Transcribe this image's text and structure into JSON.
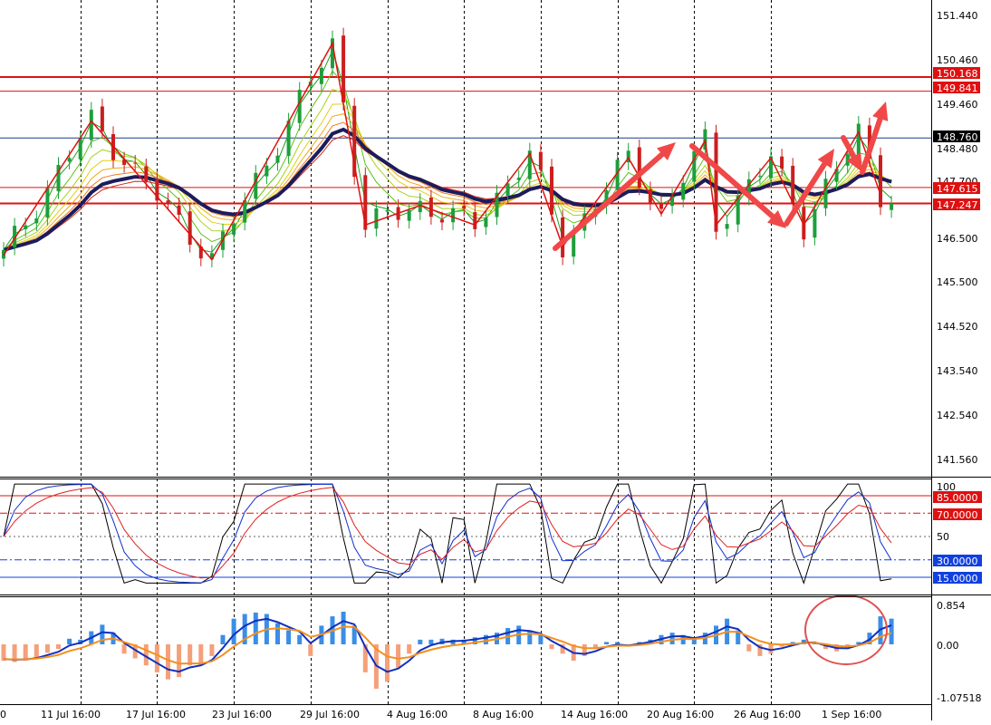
{
  "chart_data": {
    "type": "line",
    "panels": {
      "price": {
        "y_ticks": [
          "151.440",
          "150.460",
          "149.460",
          "148.480",
          "146.500",
          "145.500",
          "144.520",
          "143.540",
          "142.540",
          "141.560"
        ],
        "y_tick_values": [
          151.44,
          150.46,
          149.46,
          148.48,
          146.5,
          145.5,
          144.52,
          143.54,
          142.54,
          141.56
        ],
        "ylim": [
          140.95,
          151.95
        ],
        "horizontal_levels": [
          {
            "label": "150.168",
            "value": 150.168,
            "color": "#e01010"
          },
          {
            "label": "149.841",
            "value": 149.841,
            "color": "#e01010"
          },
          {
            "label": "148.760",
            "value": 148.76,
            "color": "#1f3a8a"
          },
          {
            "label": "147.615",
            "value": 147.615,
            "color": "#e01010"
          },
          {
            "label": "147.247",
            "value": 147.247,
            "color": "#e01010"
          }
        ],
        "hidden_level_text": "147.700",
        "zigzag_points": [
          [
            0,
            146.05
          ],
          [
            8,
            149.15
          ],
          [
            19,
            145.95
          ],
          [
            30,
            150.95
          ],
          [
            33,
            146.75
          ],
          [
            38,
            147.2
          ],
          [
            43,
            146.75
          ],
          [
            48,
            148.4
          ],
          [
            51,
            146.25
          ],
          [
            57,
            148.3
          ],
          [
            60,
            147.0
          ],
          [
            64,
            148.7
          ],
          [
            65,
            146.75
          ],
          [
            70,
            148.3
          ],
          [
            73,
            146.75
          ],
          [
            78,
            148.9
          ],
          [
            80,
            147.45
          ]
        ]
      },
      "oscillator": {
        "levels": [
          {
            "label": "85.0000",
            "value": 85,
            "color": "#e01010",
            "style": "solid"
          },
          {
            "label": "70.0000",
            "value": 70,
            "color": "#e01010",
            "style": "dashdot"
          },
          {
            "label": "50",
            "value": 50,
            "color": "#666666",
            "style": "dotted"
          },
          {
            "label": "30.0000",
            "value": 30,
            "color": "#1040e0",
            "style": "dashdot"
          },
          {
            "label": "15.0000",
            "value": 15,
            "color": "#1040e0",
            "style": "solid"
          }
        ],
        "top_label": "100",
        "ylim": [
          0,
          100
        ]
      },
      "macd": {
        "y_ticks": [
          "0.854",
          "0.00",
          "-1.07518"
        ],
        "y_tick_values": [
          0.854,
          0.0,
          -1.07518
        ],
        "ylim": [
          -1.12,
          1.05
        ],
        "histogram": [
          -0.35,
          -0.38,
          -0.35,
          -0.3,
          -0.18,
          -0.1,
          0.12,
          0.1,
          0.28,
          0.42,
          0.25,
          -0.2,
          -0.3,
          -0.45,
          -0.6,
          -0.75,
          -0.7,
          -0.45,
          -0.45,
          -0.25,
          0.2,
          0.55,
          0.65,
          0.68,
          0.65,
          0.45,
          0.3,
          0.2,
          -0.25,
          0.4,
          0.6,
          0.7,
          0.4,
          -0.6,
          -0.95,
          -0.8,
          -0.5,
          -0.2,
          0.1,
          0.1,
          0.12,
          0.1,
          0.1,
          0.15,
          0.2,
          0.25,
          0.35,
          0.4,
          0.3,
          0.2,
          -0.1,
          -0.2,
          -0.35,
          -0.25,
          -0.1,
          0.05,
          0.05,
          -0.05,
          0.05,
          0.1,
          0.2,
          0.25,
          0.2,
          0.1,
          0.25,
          0.4,
          0.55,
          0.3,
          -0.15,
          -0.25,
          -0.2,
          -0.05,
          0.05,
          0.1,
          0.05,
          -0.1,
          -0.15,
          -0.1,
          0.05,
          0.25,
          0.6,
          0.55
        ]
      }
    },
    "x_tick_labels": [
      "0",
      "11 Jul 16:00",
      "17 Jul 16:00",
      "23 Jul 16:00",
      "29 Jul 16:00",
      "4 Aug 16:00",
      "8 Aug 16:00",
      "14 Aug 16:00",
      "20 Aug 16:00",
      "26 Aug 16:00",
      "1 Sep 16:00"
    ],
    "x_tick_bar_index": [
      -0.5,
      7,
      14,
      21,
      28,
      35,
      42,
      49,
      56,
      63,
      70
    ],
    "bar_count": 82,
    "colors": {
      "bull_candle": "#1e9e3a",
      "bear_candle": "#cc1e1e",
      "slow_ma": "#1c1c5c",
      "level_line": "#e01010",
      "current_price_line": "#1f3a8a",
      "macd_hist_pos": "#3a8ee6",
      "macd_hist_neg": "#f4a07a",
      "macd_line": "#1030c0",
      "signal_line": "#f39020",
      "arrow": "#f04848"
    }
  }
}
